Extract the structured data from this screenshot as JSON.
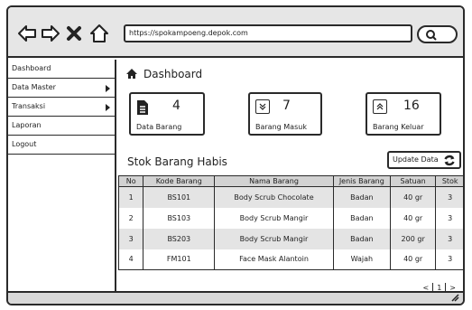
{
  "browser": {
    "url": "https://spokampoeng.depok.com"
  },
  "sidebar": {
    "items": [
      {
        "label": "Dashboard"
      },
      {
        "label": "Data Master"
      },
      {
        "label": "Transaksi"
      },
      {
        "label": "Laporan"
      },
      {
        "label": "Logout"
      }
    ]
  },
  "main": {
    "title": "Dashboard",
    "cards": [
      {
        "value": "4",
        "label": "Data Barang"
      },
      {
        "value": "7",
        "label": "Barang Masuk"
      },
      {
        "value": "16",
        "label": "Barang Keluar"
      }
    ],
    "section_title": "Stok Barang Habis",
    "update_label": "Update Data"
  },
  "table": {
    "headers": [
      "No",
      "Kode Barang",
      "Nama Barang",
      "Jenis Barang",
      "Satuan",
      "Stok"
    ],
    "rows": [
      [
        "1",
        "BS101",
        "Body Scrub Chocolate",
        "Badan",
        "40 gr",
        "3"
      ],
      [
        "2",
        "BS103",
        "Body Scrub Mangir",
        "Badan",
        "40 gr",
        "3"
      ],
      [
        "3",
        "BS203",
        "Body Scrub Mangir",
        "Badan",
        "200 gr",
        "3"
      ],
      [
        "4",
        "FM101",
        "Face Mask Alantoin",
        "Wajah",
        "40 gr",
        "3"
      ]
    ]
  },
  "pager": {
    "prev": "<",
    "page": "1",
    "next": ">"
  },
  "icons": {
    "back": "arrow-left-icon",
    "forward": "arrow-right-icon",
    "stop": "close-icon",
    "home": "home-icon",
    "search": "search-icon",
    "dashboard": "home-icon",
    "data_barang": "document-icon",
    "barang_masuk": "chevron-down-icon",
    "barang_keluar": "chevron-up-icon",
    "refresh": "refresh-icon"
  }
}
